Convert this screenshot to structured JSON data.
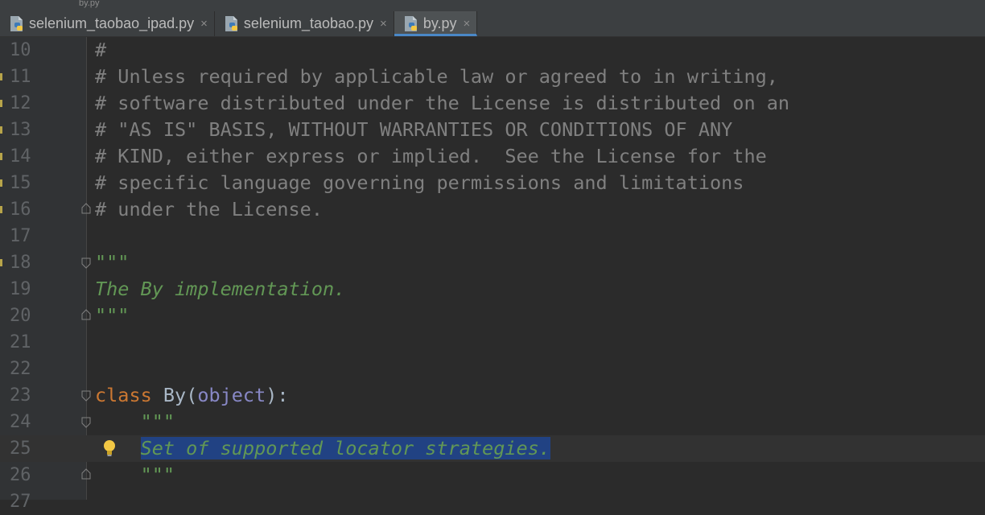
{
  "breadcrumb": [
    "",
    "",
    "",
    "",
    "",
    "",
    "",
    "by.py"
  ],
  "tabs": [
    {
      "label": "selenium_taobao_ipad.py",
      "close": "×",
      "active": false
    },
    {
      "label": "selenium_taobao.py",
      "close": "×",
      "active": false
    },
    {
      "label": "by.py",
      "close": "×",
      "active": true
    }
  ],
  "editor": {
    "lines": [
      {
        "num": "10",
        "parts": [
          {
            "t": "#",
            "c": "comment"
          }
        ]
      },
      {
        "num": "11",
        "parts": [
          {
            "t": "# Unless required by applicable law or agreed to in writing,",
            "c": "comment"
          }
        ]
      },
      {
        "num": "12",
        "parts": [
          {
            "t": "# software distributed under the License is distributed on an",
            "c": "comment"
          }
        ]
      },
      {
        "num": "13",
        "parts": [
          {
            "t": "# \"AS IS\" BASIS, WITHOUT WARRANTIES OR CONDITIONS OF ANY",
            "c": "comment"
          }
        ]
      },
      {
        "num": "14",
        "parts": [
          {
            "t": "# KIND, either express or implied.  See the License for the",
            "c": "comment"
          }
        ]
      },
      {
        "num": "15",
        "parts": [
          {
            "t": "# specific language governing permissions and limitations",
            "c": "comment"
          }
        ]
      },
      {
        "num": "16",
        "parts": [
          {
            "t": "# under the License.",
            "c": "comment"
          }
        ]
      },
      {
        "num": "17",
        "parts": []
      },
      {
        "num": "18",
        "parts": [
          {
            "t": "\"\"\"",
            "c": "doc"
          }
        ]
      },
      {
        "num": "19",
        "parts": [
          {
            "t": "The By implementation.",
            "c": "doc"
          }
        ]
      },
      {
        "num": "20",
        "parts": [
          {
            "t": "\"\"\"",
            "c": "doc"
          }
        ]
      },
      {
        "num": "21",
        "parts": []
      },
      {
        "num": "22",
        "parts": []
      },
      {
        "num": "23",
        "parts": [
          {
            "t": "class",
            "c": "kw"
          },
          {
            "t": " By(",
            "c": "ident"
          },
          {
            "t": "object",
            "c": "builtin"
          },
          {
            "t": "):",
            "c": "ident"
          }
        ]
      },
      {
        "num": "24",
        "parts": [
          {
            "t": "    ",
            "c": "ident"
          },
          {
            "t": "\"\"\"",
            "c": "doc"
          }
        ]
      },
      {
        "num": "25",
        "parts": [
          {
            "t": "    ",
            "c": "ident"
          },
          {
            "t": "Set of supported locator strategies.",
            "c": "doc sel"
          }
        ],
        "current": true
      },
      {
        "num": "26",
        "parts": [
          {
            "t": "    ",
            "c": "ident"
          },
          {
            "t": "\"\"\"",
            "c": "doc"
          }
        ]
      },
      {
        "num": "27",
        "parts": []
      }
    ]
  },
  "colors": {
    "background": "#2b2b2b",
    "comment": "#808080",
    "docstring": "#629755",
    "keyword": "#cc7832",
    "selection": "#214283",
    "tab_underline": "#4a88c7"
  }
}
